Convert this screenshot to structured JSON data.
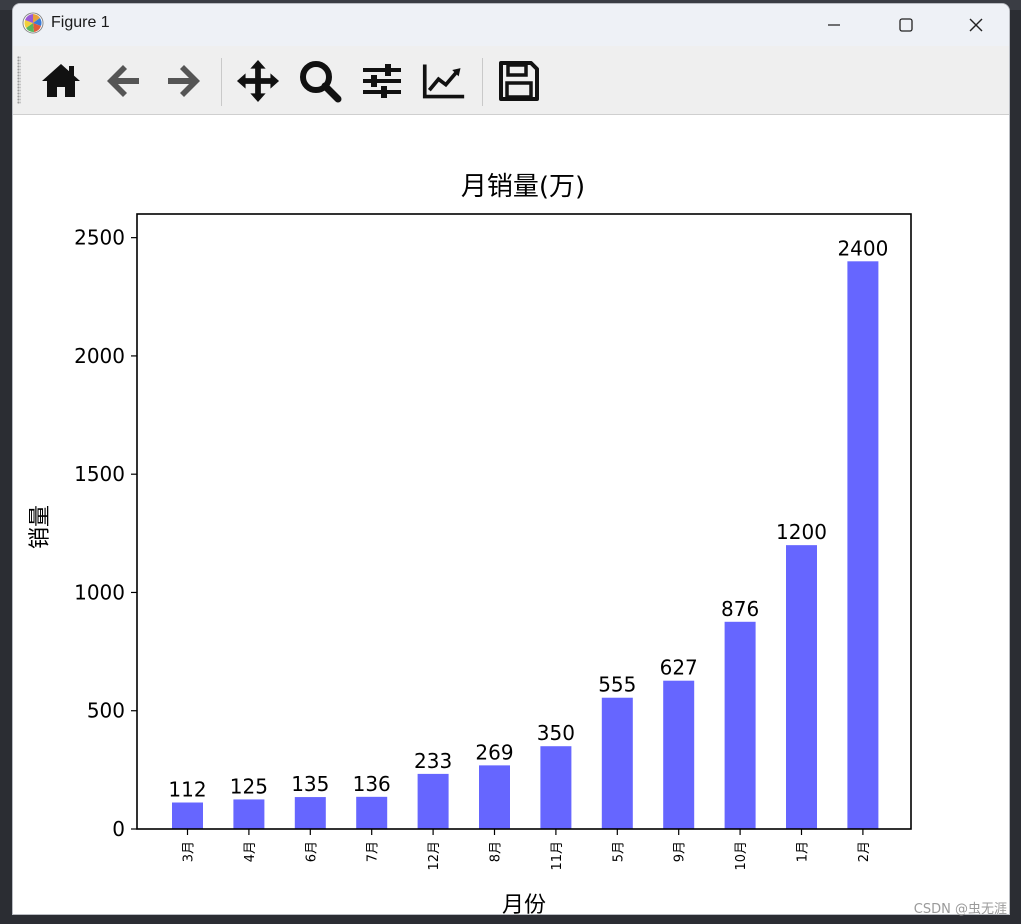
{
  "window": {
    "title": "Figure 1"
  },
  "toolbar": {
    "tools": [
      {
        "name": "home",
        "icon": "home-icon"
      },
      {
        "name": "back",
        "icon": "arrow-left-icon"
      },
      {
        "name": "forward",
        "icon": "arrow-right-icon"
      },
      {
        "name": "pan",
        "icon": "move-icon"
      },
      {
        "name": "zoom",
        "icon": "magnifier-icon"
      },
      {
        "name": "subplots",
        "icon": "sliders-icon"
      },
      {
        "name": "edit-axes",
        "icon": "line-chart-icon"
      },
      {
        "name": "save",
        "icon": "floppy-disk-icon"
      }
    ]
  },
  "chart_data": {
    "type": "bar",
    "title": "月销量(万)",
    "xlabel": "月份",
    "ylabel": "销量",
    "categories": [
      "3月",
      "4月",
      "6月",
      "7月",
      "12月",
      "8月",
      "11月",
      "5月",
      "9月",
      "10月",
      "1月",
      "2月"
    ],
    "values": [
      112,
      125,
      135,
      136,
      233,
      269,
      350,
      555,
      627,
      876,
      1200,
      2400
    ],
    "ylim": [
      0,
      2600
    ],
    "yticks": [
      0,
      500,
      1000,
      1500,
      2000,
      2500
    ],
    "bar_color": "#6666ff",
    "grid": false,
    "legend": false
  },
  "watermark": "CSDN @虫无涯"
}
